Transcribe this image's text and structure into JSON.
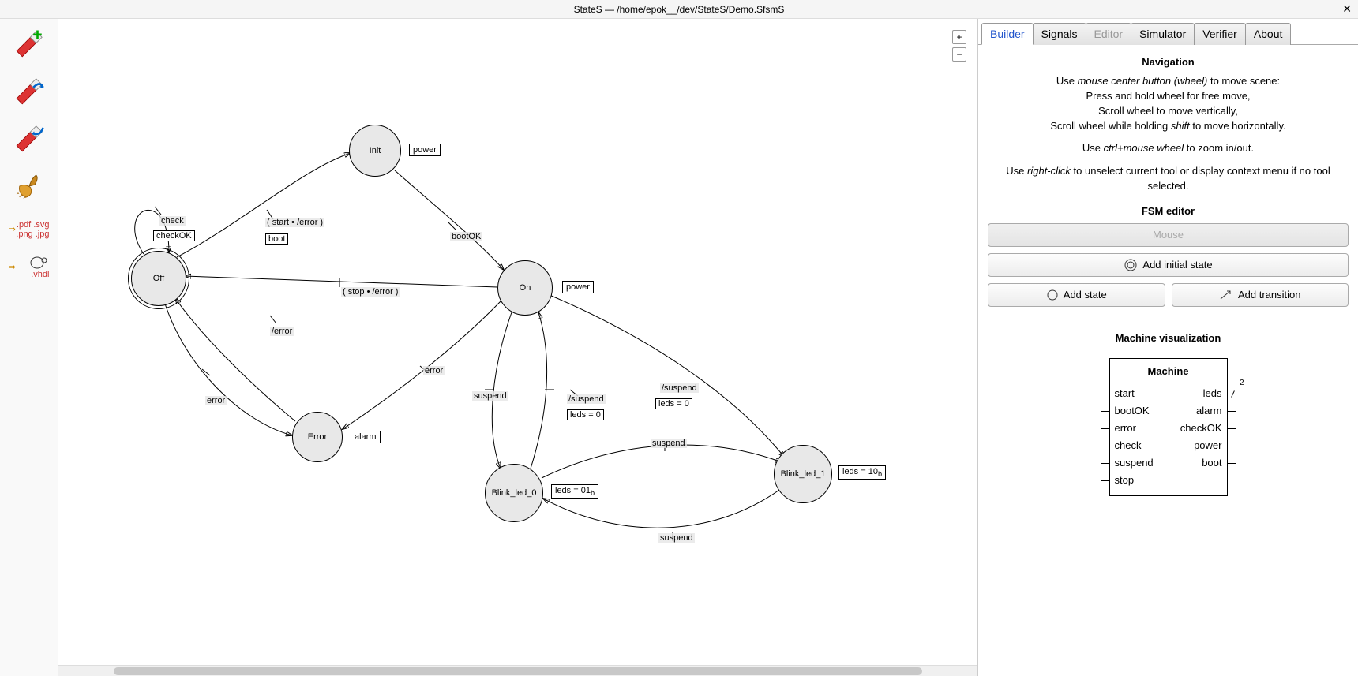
{
  "window": {
    "title": "StateS — /home/epok__/dev/StateS/Demo.SfsmS"
  },
  "zoom": {
    "in": "+",
    "out": "−"
  },
  "tabs": {
    "builder": "Builder",
    "signals": "Signals",
    "editor": "Editor",
    "simulator": "Simulator",
    "verifier": "Verifier",
    "about": "About"
  },
  "panel": {
    "nav_heading": "Navigation",
    "nav_line1_pre": "Use ",
    "nav_line1_em": "mouse center button (wheel)",
    "nav_line1_post": " to move scene:",
    "nav_line2": "Press and hold wheel for free move,",
    "nav_line3": "Scroll wheel to move vertically,",
    "nav_line4_pre": "Scroll wheel while holding ",
    "nav_line4_em": "shift",
    "nav_line4_post": " to move horizontally.",
    "nav_line5_pre": "Use ",
    "nav_line5_em": "ctrl+mouse wheel",
    "nav_line5_post": " to zoom in/out.",
    "nav_line6_pre": "Use ",
    "nav_line6_em": "right-click",
    "nav_line6_post": " to unselect current tool or display context menu if no tool selected.",
    "fsm_heading": "FSM editor",
    "btn_mouse": "Mouse",
    "btn_add_initial": "Add initial state",
    "btn_add_state": "Add state",
    "btn_add_transition": "Add transition",
    "vis_heading": "Machine visualization",
    "machine_title": "Machine",
    "inputs": [
      "start",
      "bootOK",
      "error",
      "check",
      "suspend",
      "stop"
    ],
    "outputs": [
      "leds",
      "alarm",
      "checkOK",
      "power",
      "boot"
    ]
  },
  "states": {
    "off": {
      "name": "Off"
    },
    "init": {
      "name": "Init",
      "out": "power"
    },
    "on": {
      "name": "On",
      "out": "power"
    },
    "error": {
      "name": "Error",
      "out": "alarm"
    },
    "b0": {
      "name": "Blink_led_0",
      "out": "leds = 01"
    },
    "b1": {
      "name": "Blink_led_1",
      "out": "leds = 10"
    }
  },
  "edges": {
    "off_self_cond": "check",
    "off_self_act": "checkOK",
    "off_init_cond": "( start • /error )",
    "off_init_act": "boot",
    "init_on": "bootOK",
    "on_off": "( stop • /error )",
    "off_error_cond": "error",
    "off_error_act": "/error",
    "on_error": "error",
    "on_b0": "suspend",
    "b0_on_cond": "/suspend",
    "b0_on_act": "leds = 0",
    "on_b1_cond": "/suspend",
    "on_b1_act": "leds = 0",
    "b1_b0": "suspend",
    "b0_b1": "suspend"
  },
  "export": {
    "pdf": ".pdf",
    "svg": ".svg",
    "png": ".png",
    "jpg": ".jpg",
    "vhdl": ".vhdl"
  }
}
